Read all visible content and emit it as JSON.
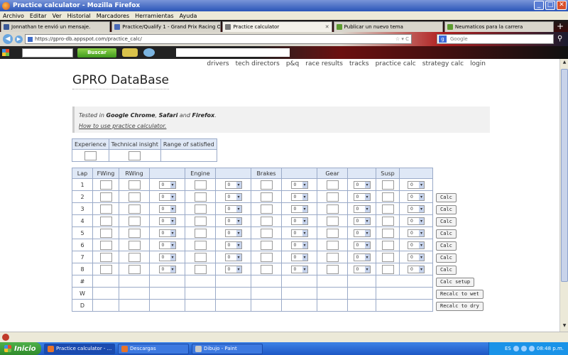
{
  "window": {
    "title": "Practice calculator - Mozilla Firefox"
  },
  "menu": [
    "Archivo",
    "Editar",
    "Ver",
    "Historial",
    "Marcadores",
    "Herramientas",
    "Ayuda"
  ],
  "tabs": [
    {
      "label": "Jonnathan te envió un mensaje.",
      "color": "#3b5998"
    },
    {
      "label": "Practice/Qualify 1 - Grand Prix Racing On...",
      "color": "#4a6ab8"
    },
    {
      "label": "Practice calculator",
      "color": "#777",
      "active": true
    },
    {
      "label": "Publicar un nuevo tema",
      "color": "#5c9b2f"
    },
    {
      "label": "Neumaticos para la carrera",
      "color": "#5c9b2f"
    }
  ],
  "url": "https://gpro-db.appspot.com/practice_calc/",
  "search_placeholder": "Google",
  "toolbar": {
    "buscar": "Buscar"
  },
  "site": {
    "title": "GPRO DataBase",
    "nav": [
      "drivers",
      "tech directors",
      "p&q",
      "race results",
      "tracks",
      "practice calc",
      "strategy calc",
      "login"
    ],
    "tested_in": "Tested in",
    "browsers": [
      "Google Chrome",
      "Safari",
      "Firefox"
    ],
    "howto": "How to use practice calculator."
  },
  "info_table": {
    "headers": [
      "Experience",
      "Technical insight",
      "Range of satisfied"
    ]
  },
  "practice_table": {
    "headers": [
      "Lap",
      "FWing",
      "RWing",
      "",
      "Engine",
      "",
      "Brakes",
      "",
      "Gear",
      "",
      "Susp",
      ""
    ],
    "laps": [
      "1",
      "2",
      "3",
      "4",
      "5",
      "6",
      "7",
      "8"
    ],
    "extra_rows": [
      "#",
      "W",
      "D"
    ],
    "select_value": "0"
  },
  "buttons": {
    "calc": "Calc",
    "calc_setup": "Calc setup",
    "recalc_wet": "Recalc to wet",
    "recalc_dry": "Recalc to dry"
  },
  "taskbar": {
    "start": "Inicio",
    "tasks": [
      {
        "label": "Practice calculator - ...",
        "color": "#e8742a"
      },
      {
        "label": "Descargas",
        "color": "#e8742a"
      },
      {
        "label": "Dibujo - Paint",
        "color": "#c8c8c8"
      }
    ],
    "lang": "ES",
    "time": "08:48 p.m."
  }
}
